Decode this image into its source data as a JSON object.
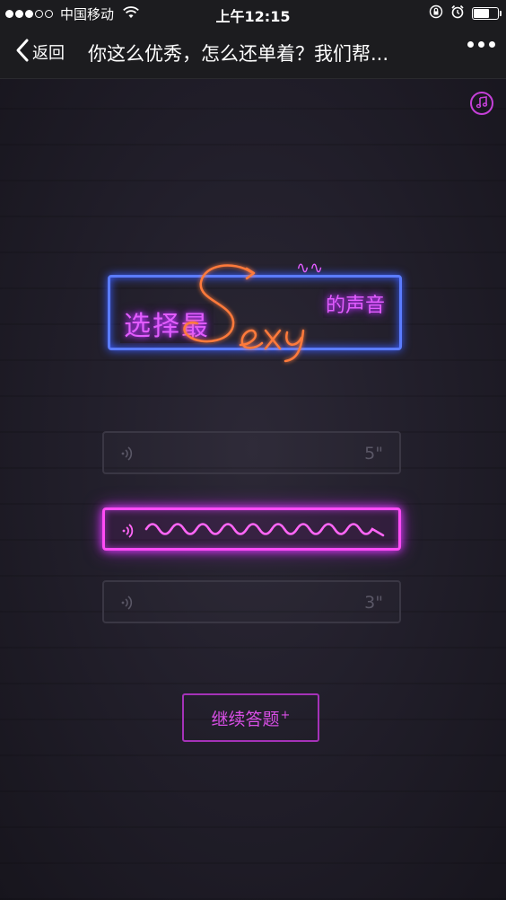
{
  "status_bar": {
    "carrier": "中国移动",
    "time": "上午12:15",
    "signal_bars_filled": 3,
    "signal_bars_total": 5,
    "battery_level": 0.6
  },
  "nav": {
    "back_label": "返回",
    "title": "你这么优秀，怎么还单着？我们帮..."
  },
  "neon_sign": {
    "left_text": "选择最",
    "script_text": "Sexy",
    "right_text": "的声音"
  },
  "voice_options": [
    {
      "duration": "5\"",
      "state": "inactive"
    },
    {
      "duration": "",
      "state": "playing"
    },
    {
      "duration": "3\"",
      "state": "inactive"
    }
  ],
  "continue_button": {
    "label": "继续答题",
    "suffix": "+"
  },
  "colors": {
    "neon_pink": "#e25cff",
    "neon_blue": "#5b7cff",
    "neon_orange": "#ff7a3a",
    "active_border": "#ff4cf5",
    "background": "#221f2b"
  },
  "icons": {
    "back": "chevron-left-icon",
    "more": "more-dots-icon",
    "music": "music-note-icon",
    "speaker": "speaker-wave-icon",
    "wifi": "wifi-icon",
    "lock": "orientation-lock-icon",
    "alarm": "alarm-icon",
    "battery": "battery-icon"
  }
}
